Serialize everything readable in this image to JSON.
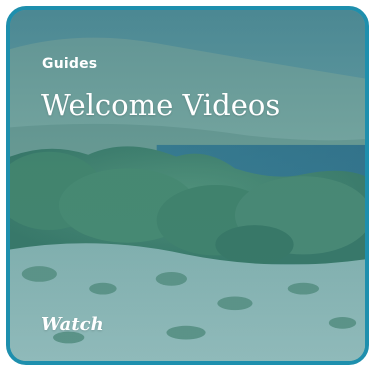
{
  "card": {
    "eyebrow": "Guides",
    "title": "Welcome Videos",
    "cta": "Watch"
  },
  "colors": {
    "border": "#1e8fad",
    "text": "#ffffff",
    "overlay": "#1c6e7d"
  },
  "image": {
    "subject": "landscape-photo"
  }
}
